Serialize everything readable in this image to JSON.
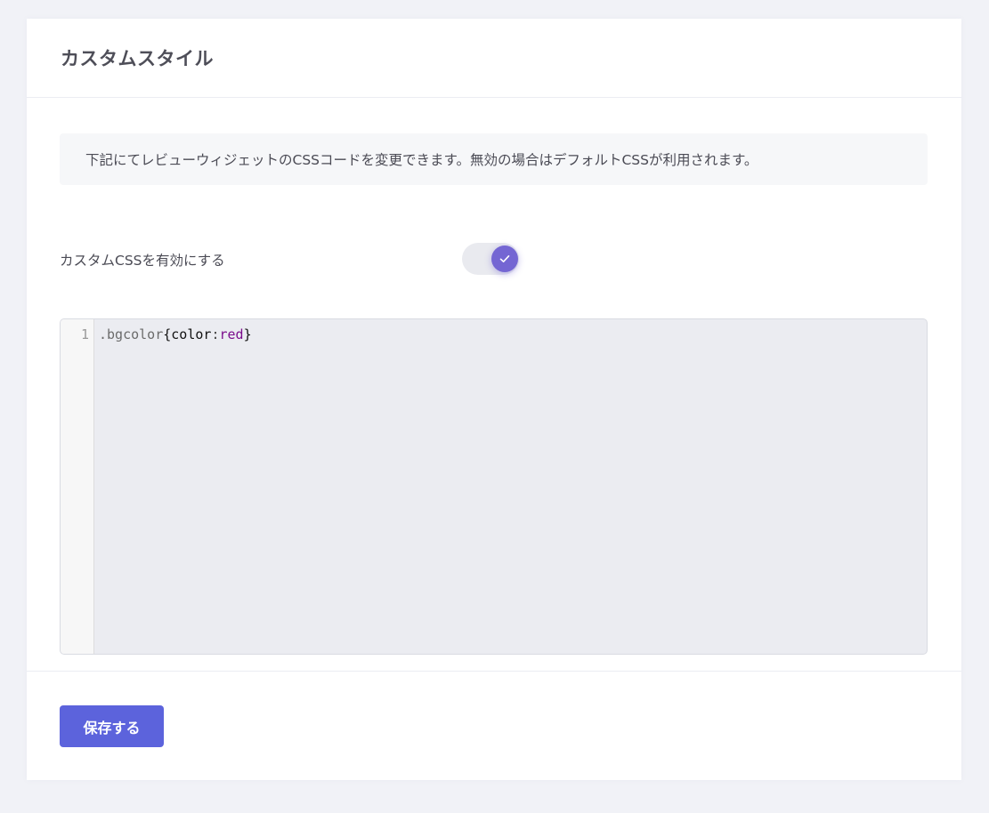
{
  "header": {
    "title": "カスタムスタイル"
  },
  "notice": {
    "text": "下記にてレビューウィジェットのCSSコードを変更できます。無効の場合はデフォルトCSSが利用されます。"
  },
  "custom_css_toggle": {
    "label": "カスタムCSSを有効にする",
    "enabled": true,
    "icon": "check-icon"
  },
  "editor": {
    "line_numbers": [
      "1"
    ],
    "lines": [
      {
        "selector": ".bgcolor",
        "open_brace": "{",
        "property": "color",
        "colon": ":",
        "value": "red",
        "close_brace": "}"
      }
    ]
  },
  "footer": {
    "save_label": "保存する"
  },
  "colors": {
    "accent": "#5c63dc",
    "toggle_knob": "#7466d3",
    "page_background": "#f1f2f7",
    "editor_background": "#ebecf1"
  }
}
